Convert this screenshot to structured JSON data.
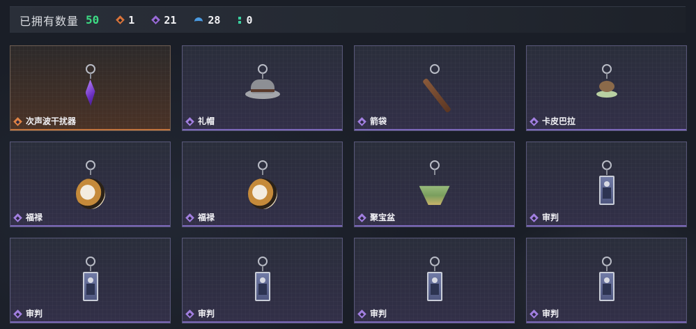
{
  "header": {
    "owned_label": "已拥有数量",
    "owned_count": "50",
    "stats": [
      {
        "icon": "orange-diamond-icon",
        "color": "#d9733a",
        "value": "1"
      },
      {
        "icon": "purple-diamond-icon",
        "color": "#9a6ad8",
        "value": "21"
      },
      {
        "icon": "blue-arch-icon",
        "color": "#4a9ae0",
        "value": "28"
      },
      {
        "icon": "green-dots-icon",
        "color": "#3ad0a0",
        "value": "0"
      }
    ]
  },
  "items": [
    {
      "name": "次声波干扰器",
      "rarity": "orange",
      "art": "crystal"
    },
    {
      "name": "礼帽",
      "rarity": "purple",
      "art": "hat"
    },
    {
      "name": "箭袋",
      "rarity": "purple",
      "art": "quiver"
    },
    {
      "name": "卡皮巴拉",
      "rarity": "purple",
      "art": "capybara"
    },
    {
      "name": "福禄",
      "rarity": "purple",
      "art": "gourd"
    },
    {
      "name": "福禄",
      "rarity": "purple",
      "art": "gourd"
    },
    {
      "name": "聚宝盆",
      "rarity": "purple",
      "art": "bowl"
    },
    {
      "name": "审判",
      "rarity": "purple",
      "art": "card"
    },
    {
      "name": "审判",
      "rarity": "purple",
      "art": "card"
    },
    {
      "name": "审判",
      "rarity": "purple",
      "art": "card"
    },
    {
      "name": "审判",
      "rarity": "purple",
      "art": "card"
    },
    {
      "name": "审判",
      "rarity": "purple",
      "art": "card"
    }
  ]
}
